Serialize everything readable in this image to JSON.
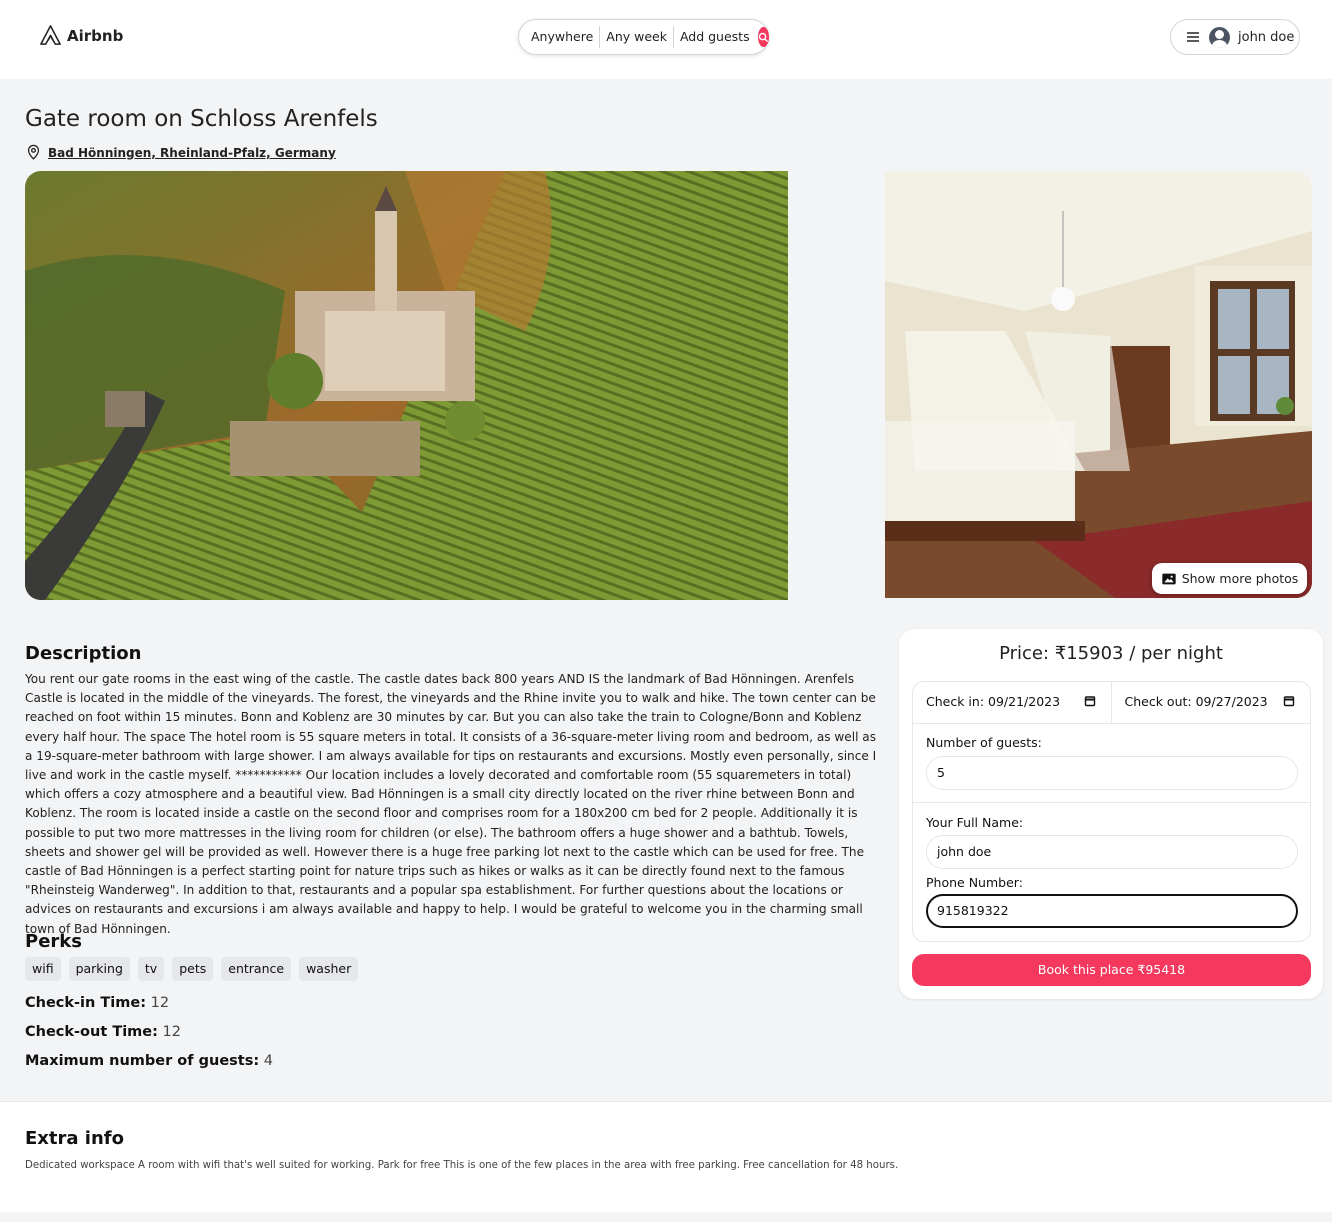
{
  "header": {
    "logo_text": "Airbnb",
    "search": {
      "anywhere": "Anywhere",
      "any_week": "Any week",
      "add_guests": "Add guests"
    },
    "user_name": "john doe"
  },
  "listing": {
    "title": "Gate room on Schloss Arenfels",
    "address": "Bad Hönningen, Rheinland-Pfalz, Germany",
    "show_more_photos": "Show more photos"
  },
  "description": {
    "heading": "Description",
    "text": "You rent our gate rooms in the east wing of the castle. The castle dates back 800 years AND IS the landmark of Bad Hönningen. Arenfels Castle is located in the middle of the vineyards. The forest, the vineyards and the Rhine invite you to walk and hike. The town center can be reached on foot within 15 minutes. Bonn and Koblenz are 30 minutes by car. But you can also take the train to Cologne/Bonn and Koblenz every half hour. The space The hotel room is 55 square meters in total. It consists of a 36-square-meter living room and bedroom, as well as a 19-square-meter bathroom with large shower. I am always available for tips on restaurants and excursions. Mostly even personally, since I live and work in the castle myself. *********** Our location includes a lovely decorated and comfortable room (55 squaremeters in total) which offers a cozy atmosphere and a beautiful view. Bad Hönningen is a small city directly located on the river rhine between Bonn and Koblenz. The room is located inside a castle on the second floor and comprises room for a 180x200 cm bed for 2 people. Additionally it is possible to put two more mattresses in the living room for children (or else). The bathroom offers a huge shower and a bathtub. Towels, sheets and shower gel will be provided as well. However there is a huge free parking lot next to the castle which can be used for free. The castle of Bad Hönningen is a perfect starting point for nature trips such as hikes or walks as it can be directly found next to the famous \"Rheinsteig Wanderweg\". In addition to that, restaurants and a popular spa establishment. For further questions about the locations or advices on restaurants and excursions i am always available and happy to help. I would be grateful to welcome you in the charming small town of Bad Hönningen."
  },
  "perks": {
    "heading": "Perks",
    "items": [
      "wifi",
      "parking",
      "tv",
      "pets",
      "entrance",
      "washer"
    ]
  },
  "details": {
    "checkin_label": "Check-in Time:",
    "checkin_value": "12",
    "checkout_label": "Check-out Time:",
    "checkout_value": "12",
    "max_guests_label": "Maximum number of guests:",
    "max_guests_value": "4"
  },
  "booking": {
    "price": "Price: ₹15903 / per night",
    "check_in": "Check in: 09/21/2023",
    "check_out": "Check out: 09/27/2023",
    "guests_label": "Number of guests:",
    "guests_value": "5",
    "name_label": "Your Full Name:",
    "name_value": "john doe",
    "phone_label": "Phone Number:",
    "phone_value": "915819322",
    "book_button": "Book this place ₹95418"
  },
  "extra_info": {
    "heading": "Extra info",
    "text": "Dedicated workspace A room with wifi that's well suited for working. Park for free This is one of the few places in the area with free parking. Free cancellation for 48 hours."
  },
  "colors": {
    "accent": "#f5385d",
    "background": "#f3f4f6"
  }
}
